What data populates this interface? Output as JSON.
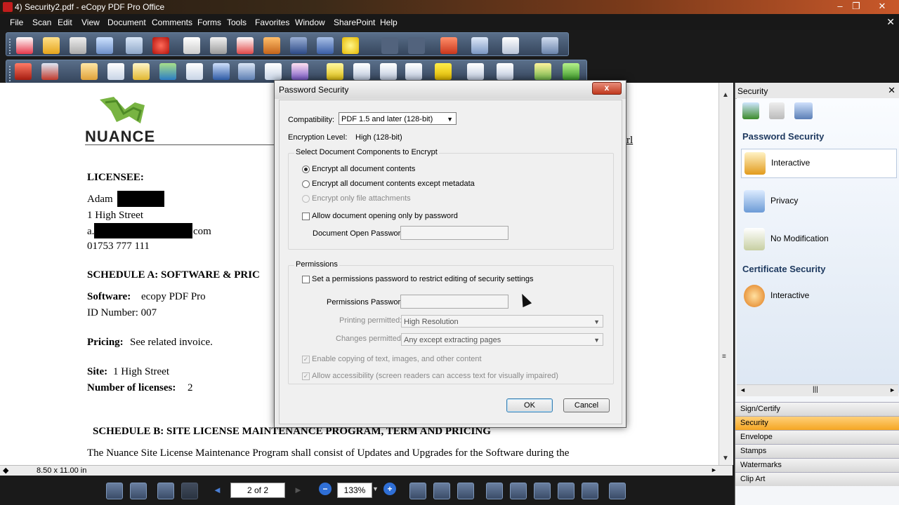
{
  "window": {
    "title": "4) Security2.pdf - eCopy PDF Pro Office"
  },
  "menu": [
    "File",
    "Scan",
    "Edit",
    "View",
    "Document",
    "Comments",
    "Forms",
    "Tools",
    "Favorites",
    "Window",
    "SharePoint",
    "Help"
  ],
  "document": {
    "logo_text": "NUANCE",
    "top_right_fragment": "rl",
    "licensee_heading": "LICENSEE:",
    "licensee_name": "Adam",
    "address1": "1 High Street",
    "email_prefix": "a.",
    "email_suffix": "com",
    "phone": "01753 777 111",
    "schedule_a": "SCHEDULE A: SOFTWARE & PRIC",
    "software_label": "Software:",
    "software_value": "ecopy PDF Pro",
    "id_number": "ID Number: 007",
    "pricing_label": "Pricing:",
    "pricing_value": "See related invoice.",
    "site_label": "Site:",
    "site_value": "1 High Street",
    "licenses_label": "Number of licenses:",
    "licenses_value": "2",
    "schedule_b": "SCHEDULE B: SITE LICENSE MAINTENANCE PROGRAM, TERM AND PRICING",
    "paragraph": "The Nuance Site License Maintenance Program shall consist of Updates and Upgrades for the Software during the"
  },
  "statusbar": {
    "page_size": "8.50 x 11.00 in"
  },
  "navbar": {
    "page_indicator": "2 of 2",
    "zoom": "133%"
  },
  "dialog": {
    "title": "Password Security",
    "close_label": "x",
    "compatibility_label": "Compatibility:",
    "compatibility_value": "PDF 1.5 and later (128-bit)",
    "encryption_level_label": "Encryption Level:",
    "encryption_level_value": "High (128-bit)",
    "components_heading": "Select Document Components to Encrypt",
    "opt_all": "Encrypt all document contents",
    "opt_except_metadata": "Encrypt all document contents except metadata",
    "opt_attachments": "Encrypt only file attachments",
    "allow_opening_password": "Allow document opening only by password",
    "open_password_label": "Document Open Password:",
    "permissions_heading": "Permissions",
    "set_permissions_password": "Set a permissions password to restrict editing of security settings",
    "permissions_password_label": "Permissions Password:",
    "printing_label": "Printing permitted:",
    "printing_value": "High Resolution",
    "changes_label": "Changes permitted:",
    "changes_value": "Any except extracting pages",
    "enable_copying": "Enable copying of text, images, and other content",
    "allow_accessibility": "Allow accessibility (screen readers can access text for visually impaired)",
    "ok": "OK",
    "cancel": "Cancel",
    "checked_mark": "✓"
  },
  "panel": {
    "title": "Security",
    "password_security_heading": "Password Security",
    "items_password": [
      "Interactive",
      "Privacy",
      "No Modification"
    ],
    "certificate_security_heading": "Certificate Security",
    "items_certificate": [
      "Interactive"
    ],
    "tabs": [
      "Sign/Certify",
      "Security",
      "Envelope",
      "Stamps",
      "Watermarks",
      "Clip Art"
    ],
    "active_tab": "Security"
  },
  "colors": {
    "accent_active_tab": "#f5a623",
    "logo_green": "#78b442",
    "section_heading": "#1f3a60"
  }
}
